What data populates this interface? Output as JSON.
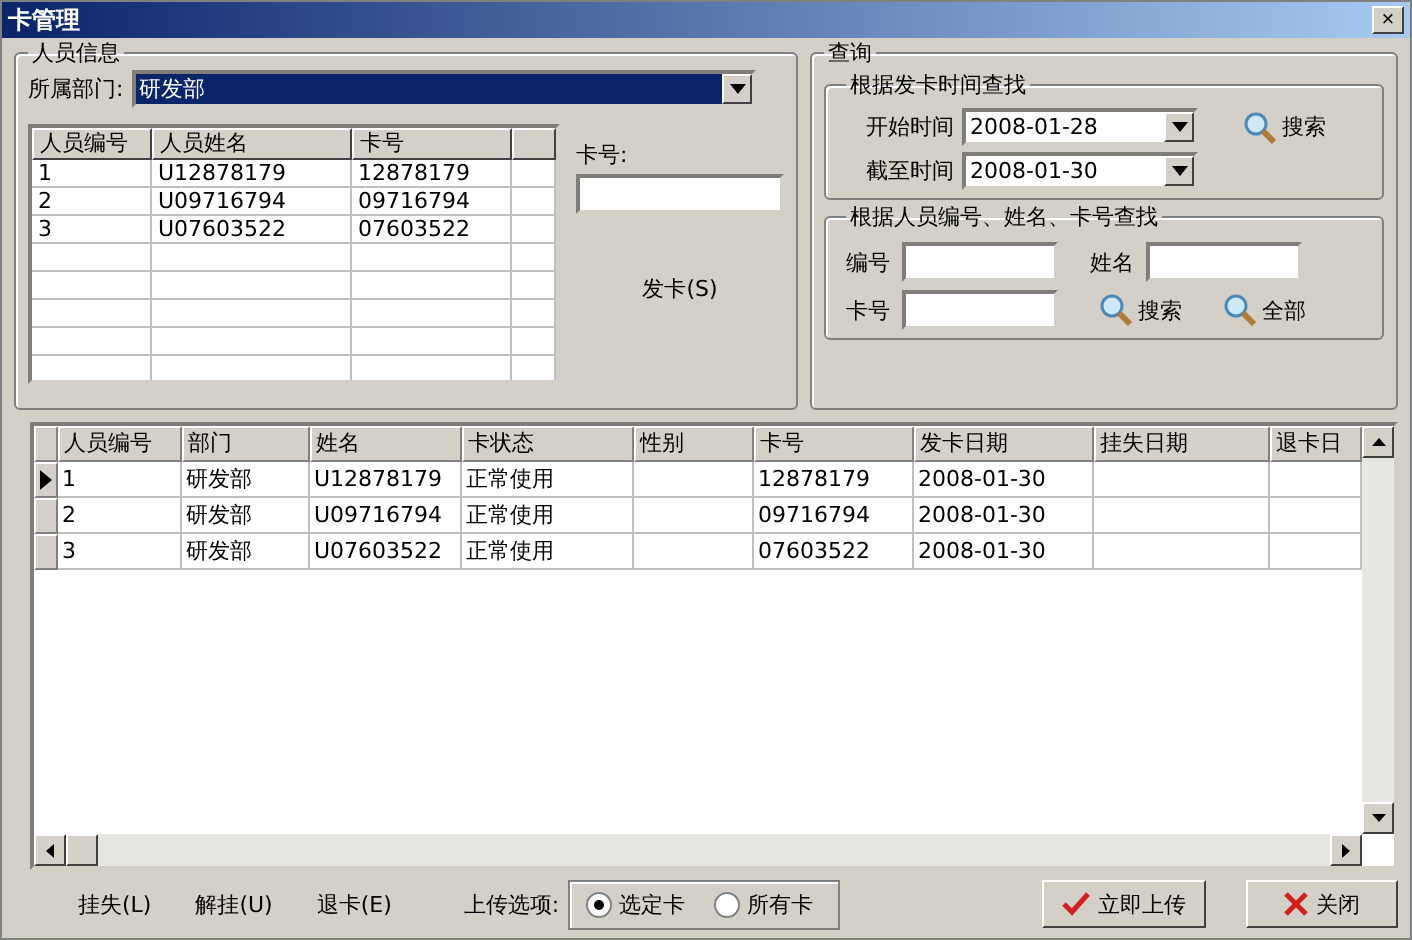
{
  "window": {
    "title": "卡管理",
    "close": "×"
  },
  "person_info": {
    "title": "人员信息",
    "dept_label": "所属部门:",
    "dept_value": "研发部",
    "columns": [
      "人员编号",
      "人员姓名",
      "卡号"
    ],
    "rows": [
      [
        "1",
        "U12878179",
        "12878179"
      ],
      [
        "2",
        "U09716794",
        "09716794"
      ],
      [
        "3",
        "U07603522",
        "07603522"
      ]
    ],
    "card_label": "卡号:",
    "issue_button": "发卡(S)"
  },
  "query": {
    "title": "查询",
    "by_time": {
      "title": "根据发卡时间查找",
      "start_label": "开始时间",
      "start_value": "2008-01-28",
      "end_label": "截至时间",
      "end_value": "2008-01-30",
      "search_button": "搜索"
    },
    "by_person": {
      "title": "根据人员编号、姓名、卡号查找",
      "id_label": "编号",
      "name_label": "姓名",
      "card_label": "卡号",
      "search_button": "搜索",
      "all_button": "全部"
    }
  },
  "table": {
    "columns": [
      "人员编号",
      "部门",
      "姓名",
      "卡状态",
      "性别",
      "卡号",
      "发卡日期",
      "挂失日期",
      "退卡日"
    ],
    "rows": [
      {
        "selected": true,
        "cells": [
          "1",
          "研发部",
          "U12878179",
          "正常使用",
          "",
          "12878179",
          "2008-01-30",
          "",
          ""
        ]
      },
      {
        "selected": false,
        "cells": [
          "2",
          "研发部",
          "U09716794",
          "正常使用",
          "",
          "09716794",
          "2008-01-30",
          "",
          ""
        ]
      },
      {
        "selected": false,
        "cells": [
          "3",
          "研发部",
          "U07603522",
          "正常使用",
          "",
          "07603522",
          "2008-01-30",
          "",
          ""
        ]
      }
    ]
  },
  "bottom": {
    "actions": [
      "挂失(L)",
      "解挂(U)",
      "退卡(E)"
    ],
    "upload_label": "上传选项:",
    "options": [
      {
        "label": "选定卡",
        "selected": true
      },
      {
        "label": "所有卡",
        "selected": false
      }
    ],
    "upload_button": "立即上传",
    "close_button": "关闭"
  }
}
